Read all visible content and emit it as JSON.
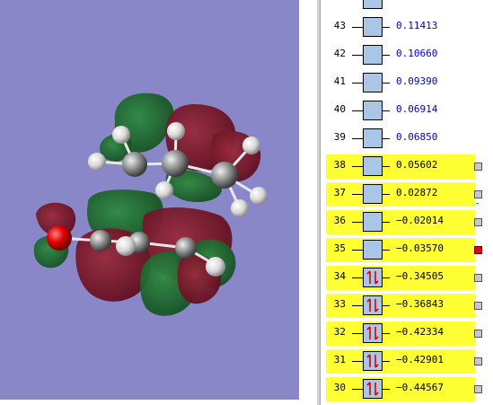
{
  "viewer": {
    "background": "#8a87c9",
    "orbital_colors": {
      "positive": "#7a1428",
      "negative": "#1e6b2e"
    }
  },
  "orbitals": [
    {
      "index": "43",
      "energy": "0.11413",
      "occupied": false,
      "highlighted": false,
      "selected": null
    },
    {
      "index": "42",
      "energy": "0.10660",
      "occupied": false,
      "highlighted": false,
      "selected": null
    },
    {
      "index": "41",
      "energy": "0.09390",
      "occupied": false,
      "highlighted": false,
      "selected": null
    },
    {
      "index": "40",
      "energy": "0.06914",
      "occupied": false,
      "highlighted": false,
      "selected": null
    },
    {
      "index": "39",
      "energy": "0.06850",
      "occupied": false,
      "highlighted": false,
      "selected": null
    },
    {
      "index": "38",
      "energy": "0.05602",
      "occupied": false,
      "highlighted": true,
      "selected": false
    },
    {
      "index": "37",
      "energy": "0.02872",
      "occupied": false,
      "highlighted": true,
      "selected": false
    },
    {
      "index": "36",
      "energy": "−0.02014",
      "occupied": false,
      "highlighted": true,
      "selected": false
    },
    {
      "index": "35",
      "energy": "−0.03570",
      "occupied": false,
      "highlighted": true,
      "selected": true
    },
    {
      "index": "34",
      "energy": "−0.34505",
      "occupied": true,
      "highlighted": true,
      "selected": false
    },
    {
      "index": "33",
      "energy": "−0.36843",
      "occupied": true,
      "highlighted": true,
      "selected": false
    },
    {
      "index": "32",
      "energy": "−0.42334",
      "occupied": true,
      "highlighted": true,
      "selected": false
    },
    {
      "index": "31",
      "energy": "−0.42901",
      "occupied": true,
      "highlighted": true,
      "selected": false
    },
    {
      "index": "30",
      "energy": "−0.44567",
      "occupied": true,
      "highlighted": true,
      "selected": false
    }
  ],
  "colors": {
    "highlight": "#ffff33",
    "level_box": "#a9c6e6",
    "virtual_energy_text": "#0000c8",
    "selected_marker": "#ee0000",
    "spin_arrows": "#dd0000"
  }
}
